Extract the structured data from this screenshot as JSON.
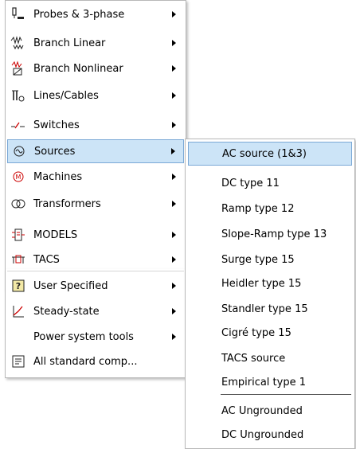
{
  "main_menu": {
    "items": [
      {
        "label": "Probes & 3-phase",
        "icon": "probe-icon"
      },
      {
        "label": "Branch Linear",
        "icon": "branch-linear-icon"
      },
      {
        "label": "Branch Nonlinear",
        "icon": "branch-nonlinear-icon"
      },
      {
        "label": "Lines/Cables",
        "icon": "lines-cables-icon"
      },
      {
        "label": "Switches",
        "icon": "switch-icon"
      },
      {
        "label": "Sources",
        "icon": "source-icon"
      },
      {
        "label": "Machines",
        "icon": "machine-icon"
      },
      {
        "label": "Transformers",
        "icon": "transformer-icon"
      },
      {
        "label": "MODELS",
        "icon": "models-icon"
      },
      {
        "label": "TACS",
        "icon": "tacs-icon"
      },
      {
        "label": "User Specified",
        "icon": "user-specified-icon"
      },
      {
        "label": "Steady-state",
        "icon": "steady-state-icon"
      },
      {
        "label": "Power system tools",
        "icon": ""
      },
      {
        "label": "All standard comp...",
        "icon": "list-icon"
      }
    ]
  },
  "sub_menu": {
    "items": [
      {
        "label": "AC source (1&3)"
      },
      {
        "label": "DC type 11"
      },
      {
        "label": "Ramp type 12"
      },
      {
        "label": "Slope-Ramp type 13"
      },
      {
        "label": "Surge type 15"
      },
      {
        "label": "Heidler type 15"
      },
      {
        "label": "Standler type 15"
      },
      {
        "label": "Cigré type 15"
      },
      {
        "label": "TACS source"
      },
      {
        "label": "Empirical type 1"
      },
      {
        "label": "AC Ungrounded"
      },
      {
        "label": "DC Ungrounded"
      }
    ]
  },
  "colors": {
    "highlight": "#cce4f7",
    "highlight_border": "#7aa8d6"
  }
}
